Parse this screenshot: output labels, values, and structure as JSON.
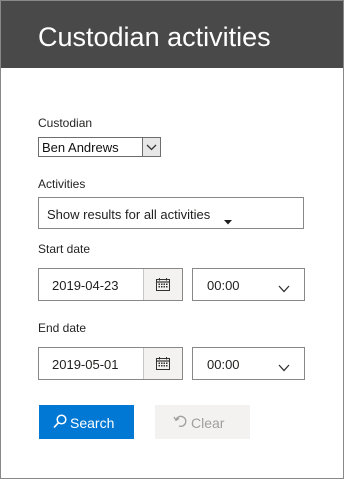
{
  "header": {
    "title": "Custodian activities"
  },
  "custodian": {
    "label": "Custodian",
    "value": "Ben Andrews"
  },
  "activities": {
    "label": "Activities",
    "value": "Show results for all activities"
  },
  "start": {
    "label": "Start date",
    "date": "2019-04-23",
    "time": "00:00"
  },
  "end": {
    "label": "End date",
    "date": "2019-05-01",
    "time": "00:00"
  },
  "buttons": {
    "search": "Search",
    "clear": "Clear"
  },
  "icons": {
    "custodian_dropdown": "chevron-down-icon",
    "activities_dropdown": "caret-down-icon",
    "date_picker": "calendar-icon",
    "time_dropdown": "chevron-down-icon",
    "search": "search-icon",
    "clear": "undo-icon"
  },
  "colors": {
    "header_bg": "#494949",
    "primary": "#0078d4",
    "disabled_bg": "#f3f2f1",
    "disabled_text": "#a19f9d"
  }
}
